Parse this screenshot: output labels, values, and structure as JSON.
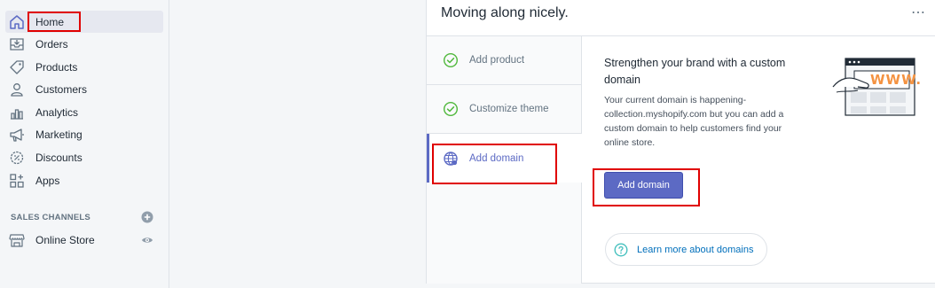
{
  "sidebar": {
    "items": [
      {
        "label": "Home",
        "icon": "home-icon"
      },
      {
        "label": "Orders",
        "icon": "orders-icon"
      },
      {
        "label": "Products",
        "icon": "tag-icon"
      },
      {
        "label": "Customers",
        "icon": "person-icon"
      },
      {
        "label": "Analytics",
        "icon": "bar-chart-icon"
      },
      {
        "label": "Marketing",
        "icon": "megaphone-icon"
      },
      {
        "label": "Discounts",
        "icon": "discount-icon"
      },
      {
        "label": "Apps",
        "icon": "apps-icon"
      }
    ],
    "sales_channels_title": "SALES CHANNELS",
    "channels": [
      {
        "label": "Online Store",
        "icon": "store-icon"
      }
    ]
  },
  "card": {
    "title": "Moving along nicely.",
    "more": "⋯",
    "steps": [
      {
        "label": "Add product",
        "status": "done"
      },
      {
        "label": "Customize theme",
        "status": "done"
      },
      {
        "label": "Add domain",
        "status": "active"
      }
    ],
    "heading": "Strengthen your brand with a custom domain",
    "body": "Your current domain is happening-collection.myshopify.com but you can add a custom domain to help customers find your online store.",
    "button": "Add domain",
    "learn_more": "Learn more about domains",
    "illustration_text": "WWW."
  },
  "colors": {
    "accent": "#5c6ac4",
    "success": "#50b83c",
    "link": "#006fbb",
    "highlight": "#e00000"
  }
}
